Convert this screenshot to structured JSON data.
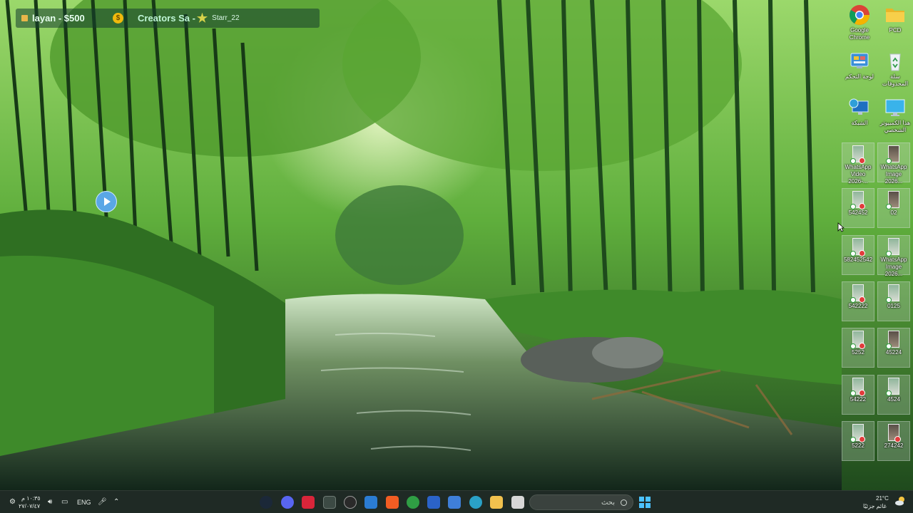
{
  "stream_overlay": {
    "donation_text": "layan - $500",
    "coin_symbol": "$",
    "subscriber_text": "Creators Sa -",
    "follower_text": "Starr_22"
  },
  "desktop_icons": [
    {
      "id": "chrome",
      "label": "Google Chrome",
      "icon": "chrome-icon"
    },
    {
      "id": "pcd",
      "label": "PCD",
      "icon": "folder-icon"
    },
    {
      "id": "control-panel",
      "label": "لوحة التحكم",
      "icon": "control-panel-icon"
    },
    {
      "id": "recycle-bin",
      "label": "سلة المحذوفات",
      "icon": "recycle-bin-icon"
    },
    {
      "id": "network",
      "label": "الشبكة",
      "icon": "network-icon"
    },
    {
      "id": "this-pc",
      "label": "هذا الكمبيوتر الشخصي",
      "icon": "monitor-icon"
    }
  ],
  "files": [
    {
      "label": "WhatsApp Video 2026-...",
      "thumb": "light"
    },
    {
      "label": "WhatsApp Image 2026...",
      "thumb": "dark"
    },
    {
      "label": "542452",
      "thumb": "light"
    },
    {
      "label": "02",
      "thumb": "dark"
    },
    {
      "label": "582452542",
      "thumb": "light"
    },
    {
      "label": "WhatsApp Image 2026...",
      "thumb": "light"
    },
    {
      "label": "542222",
      "thumb": "light"
    },
    {
      "label": "0125",
      "thumb": "light"
    },
    {
      "label": "5252",
      "thumb": "light"
    },
    {
      "label": "45224",
      "thumb": "dark"
    },
    {
      "label": "54222",
      "thumb": "light"
    },
    {
      "label": "4524",
      "thumb": "light"
    },
    {
      "label": "5222",
      "thumb": "light"
    },
    {
      "label": "274242",
      "thumb": "light"
    }
  ],
  "taskbar": {
    "search_placeholder": "بحث",
    "language": "ENG",
    "clock_time": "١٠:٣٥ م",
    "clock_date": "٢٧/٠٧/٤٧",
    "weather_temp": "21°C",
    "weather_desc": "غائم جزئيًا",
    "pinned_apps": [
      {
        "name": "steam",
        "color": "#1b2838"
      },
      {
        "name": "discord",
        "color": "#5865f2"
      },
      {
        "name": "red-app",
        "color": "#d9253a"
      },
      {
        "name": "excel-close",
        "color": "#3c4a44"
      },
      {
        "name": "obs",
        "color": "#2a2a2a"
      },
      {
        "name": "mail",
        "color": "#2b7cd3"
      },
      {
        "name": "brave",
        "color": "#f25d23"
      },
      {
        "name": "chrome",
        "color": "#2f9e44"
      },
      {
        "name": "word",
        "color": "#2b63c8"
      },
      {
        "name": "store",
        "color": "#3f7fd9"
      },
      {
        "name": "edge",
        "color": "#2aa1c7"
      },
      {
        "name": "explorer",
        "color": "#f2c14e"
      },
      {
        "name": "app-white",
        "color": "#d7d7d7"
      }
    ]
  }
}
